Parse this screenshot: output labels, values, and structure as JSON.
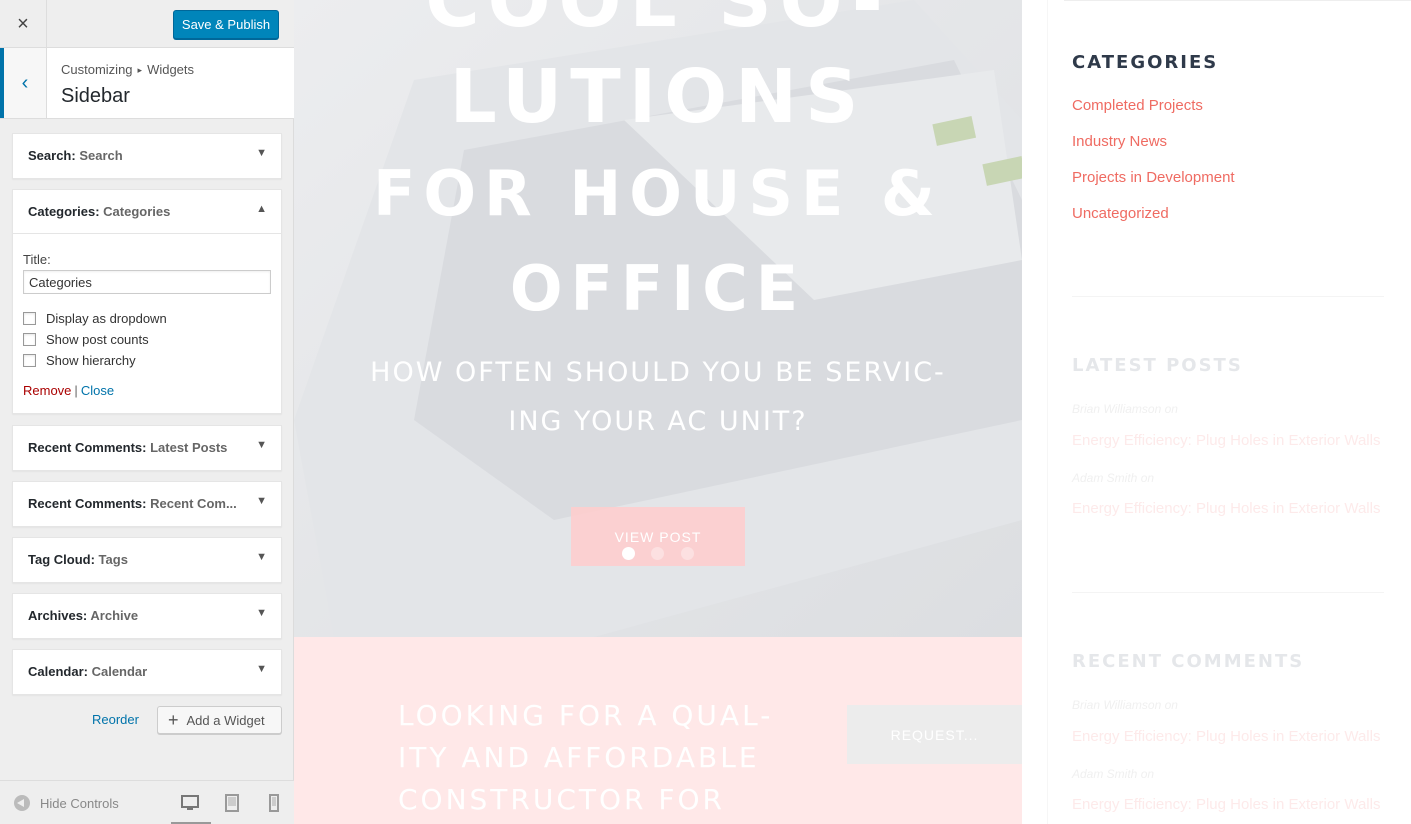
{
  "customizer": {
    "close_icon": "×",
    "save_label": "Save & Publish",
    "back_icon": "‹",
    "breadcrumb": {
      "root": "Customizing",
      "arrow": "▸",
      "current": "Widgets"
    },
    "section_title": "Sidebar",
    "widgets": [
      {
        "type": "Search",
        "name": "Search",
        "state": "collapsed"
      },
      {
        "type": "Categories",
        "name": "Categories",
        "state": "expanded"
      },
      {
        "type": "Recent Comments",
        "name": "Latest Posts",
        "state": "collapsed"
      },
      {
        "type": "Recent Comments",
        "name": "Recent Com...",
        "state": "collapsed"
      },
      {
        "type": "Tag Cloud",
        "name": "Tags",
        "state": "collapsed"
      },
      {
        "type": "Archives",
        "name": "Archive",
        "state": "collapsed"
      },
      {
        "type": "Calendar",
        "name": "Calendar",
        "state": "collapsed"
      }
    ],
    "toggle_down": "▼",
    "toggle_up": "▲",
    "categories_form": {
      "title_label": "Title:",
      "title_value": "Categories",
      "options": [
        "Display as dropdown",
        "Show post counts",
        "Show hierarchy"
      ],
      "remove_label": "Remove",
      "separator": "|",
      "close_label": "Close"
    },
    "reorder_label": "Reorder",
    "add_widget_plus": "+",
    "add_widget_label": "Add a Widget",
    "hide_controls_label": "Hide Controls",
    "preview_devices": [
      "desktop",
      "tablet",
      "mobile"
    ],
    "active_device": "desktop",
    "accent_color": "#0085ba"
  },
  "preview": {
    "hero": {
      "lines": [
        "COOL SO-",
        "LUTIONS",
        "FOR HOUSE &",
        "OFFICE"
      ],
      "subtitle_lines": [
        "HOW OFTEN SHOULD YOU BE SERVIC-",
        "ING YOUR AC UNIT?"
      ],
      "button_label": "VIEW POST",
      "slides": 3,
      "active_slide": 1
    },
    "cta": {
      "lines": [
        "LOOKING FOR A QUAL-",
        "ITY AND AFFORDABLE",
        "CONSTRUCTOR FOR"
      ],
      "button_label": "REQUEST..."
    },
    "sidebar": {
      "categories_heading": "CATEGORIES",
      "categories": [
        "Completed Projects",
        "Industry News",
        "Projects in Development",
        "Uncategorized"
      ],
      "latest_heading": "LATEST POSTS",
      "latest": [
        {
          "meta": "Brian Williamson  on",
          "link": "Energy Efficiency: Plug Holes in Exterior Walls"
        },
        {
          "meta": "Adam Smith  on",
          "link": "Energy Efficiency: Plug Holes in Exterior Walls"
        }
      ],
      "comments_heading": "RECENT COMMENTS",
      "comments": [
        {
          "meta": "Brian Williamson  on",
          "link": "Energy Efficiency: Plug Holes in Exterior Walls"
        },
        {
          "meta": "Adam Smith  on",
          "link": "Energy Efficiency: Plug Holes in Exterior Walls"
        }
      ],
      "link_color": "#ef6b62"
    }
  }
}
